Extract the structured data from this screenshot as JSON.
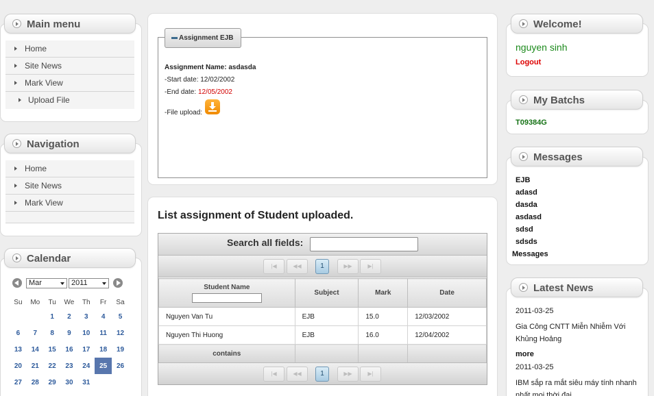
{
  "main_menu": {
    "title": "Main menu",
    "items": [
      "Home",
      "Site News",
      "Mark View",
      "Upload File"
    ]
  },
  "navigation": {
    "title": "Navigation",
    "items": [
      "Home",
      "Site News",
      "Mark View"
    ]
  },
  "calendar": {
    "title": "Calendar",
    "month": "Mar",
    "year": "2011",
    "weekdays": [
      "Su",
      "Mo",
      "Tu",
      "We",
      "Th",
      "Fr",
      "Sa"
    ],
    "weeks": [
      [
        "",
        "",
        "1",
        "2",
        "3",
        "4",
        "5"
      ],
      [
        "6",
        "7",
        "8",
        "9",
        "10",
        "11",
        "12"
      ],
      [
        "13",
        "14",
        "15",
        "16",
        "17",
        "18",
        "19"
      ],
      [
        "20",
        "21",
        "22",
        "23",
        "24",
        "25",
        "26"
      ],
      [
        "27",
        "28",
        "29",
        "30",
        "31",
        "",
        ""
      ]
    ],
    "today": "25"
  },
  "assignment": {
    "legend": "Assignment EJB",
    "name_label": "Assignment Name:",
    "name_value": "asdasda",
    "start_label": "-Start date:",
    "start_value": "12/02/2002",
    "end_label": "-End date:",
    "end_value": "12/05/2002",
    "upload_label": "-File upload:"
  },
  "uploads": {
    "title": "List assignment of Student uploaded.",
    "search_label": "Search all fields:",
    "search_value": "",
    "pager": {
      "first": "|◀",
      "prev": "◀◀",
      "page": "1",
      "next": "▶▶",
      "last": "▶|"
    },
    "columns": [
      "Student Name",
      "Subject",
      "Mark",
      "Date"
    ],
    "rows": [
      [
        "Nguyen Van Tu",
        "EJB",
        "15.0",
        "12/03/2002"
      ],
      [
        "Nguyen Thi Huong",
        "EJB",
        "16.0",
        "12/04/2002"
      ]
    ],
    "footer": [
      "contains",
      "",
      "",
      ""
    ]
  },
  "welcome": {
    "title": "Welcome!",
    "user": "nguyen sinh",
    "logout": "Logout"
  },
  "batchs": {
    "title": "My Batchs",
    "items": [
      "T09384G"
    ]
  },
  "messages": {
    "title": "Messages",
    "items": [
      "EJB",
      "adasd",
      "dasda",
      "asdasd",
      "sdsd",
      "sdsds"
    ],
    "footer": "Messages"
  },
  "news": {
    "title": "Latest News",
    "items": [
      {
        "date": "2011-03-25",
        "text": "Gia Công CNTT Miễn Nhiễm Với Khủng Hoảng"
      },
      {
        "date": "2011-03-25",
        "text": "IBM sắp ra mắt siêu máy tính nhanh nhất mọi thời đại"
      }
    ],
    "more": "more"
  },
  "colors": {
    "accent_blue": "#5876ad",
    "welcome_green": "#1c8a1c",
    "logout_red": "#dd0000",
    "batch_green": "#157215",
    "end_date_red": "#d20000"
  },
  "icons": [
    "download-icon",
    "circle-arrow-icon",
    "chevron-right-icon",
    "minus-icon"
  ]
}
